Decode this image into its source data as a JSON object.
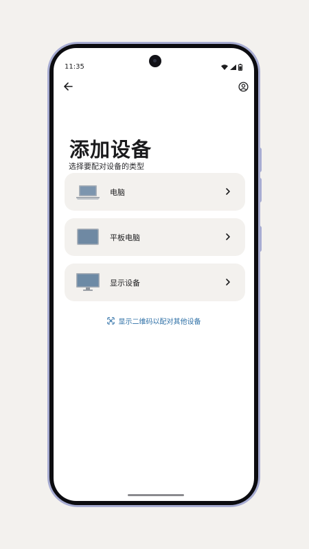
{
  "status_bar": {
    "time": "11:35"
  },
  "toolbar": {
    "back_icon": "arrow-left-icon",
    "account_icon": "account-circle-icon"
  },
  "header": {
    "title": "添加设备",
    "subtitle": "选择要配对设备的类型"
  },
  "devices": [
    {
      "label": "电脑",
      "icon": "laptop-icon"
    },
    {
      "label": "平板电脑",
      "icon": "tablet-icon"
    },
    {
      "label": "显示设备",
      "icon": "monitor-icon"
    }
  ],
  "qr_link": {
    "label": "显示二维码以配对其他设备",
    "icon": "qr-code-icon",
    "color": "#2d6fa6"
  },
  "colors": {
    "card_bg": "#f3f1ee",
    "phone_frame": "#a7acd2",
    "screen_bg": "#ffffff"
  }
}
